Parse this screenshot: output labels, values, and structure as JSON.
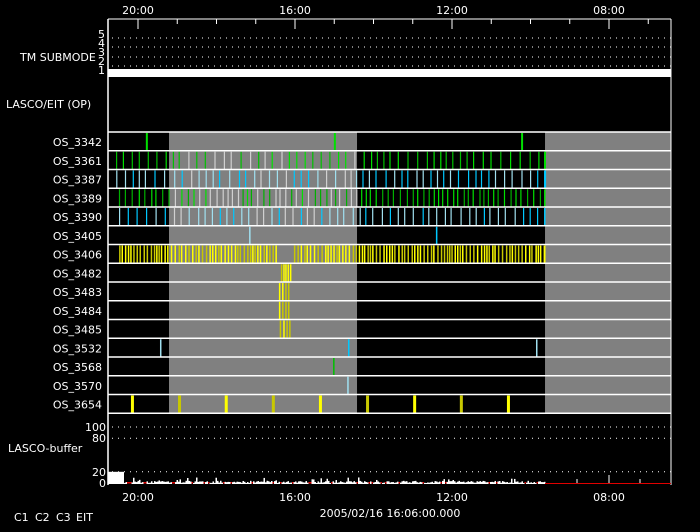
{
  "chart_data": {
    "type": "timeline",
    "x_axis": {
      "tick_labels": [
        "20:00",
        "16:00",
        "12:00",
        "08:00"
      ],
      "tick_hours": [
        20,
        16,
        12,
        8
      ],
      "range_hours": [
        20.76,
        6.42
      ]
    },
    "date_label": "2005/02/16 16:06:00.000",
    "tm_submode": {
      "label": "TM SUBMODE",
      "levels": [
        "5",
        "4",
        "3",
        "2",
        "1"
      ],
      "value": 1
    },
    "lasco_eit_label": "LASCO/EIT (OP)",
    "shaded_intervals_hours": [
      [
        19.21,
        14.42
      ],
      [
        9.63,
        6.42
      ]
    ],
    "rows": [
      {
        "name": "OS_3342",
        "events": [
          {
            "t": 19.8,
            "color": "#00e000"
          },
          {
            "t": 15.01,
            "color": "#00e000"
          },
          {
            "t": 10.24,
            "color": "#00e000"
          }
        ]
      },
      {
        "name": "OS_3361",
        "pattern": "dense",
        "colors": [
          "#00e000",
          "#00c000"
        ]
      },
      {
        "name": "OS_3387",
        "pattern": "dense",
        "colors": [
          "#00c8ff",
          "#a0e0f0"
        ]
      },
      {
        "name": "OS_3389",
        "pattern": "dense",
        "colors": [
          "#00e000",
          "#00b000"
        ]
      },
      {
        "name": "OS_3390",
        "pattern": "dense",
        "colors": [
          "#00c8ff",
          "#a0e0f0"
        ]
      },
      {
        "name": "OS_3405",
        "events": [
          {
            "t": 17.17,
            "color": "#a0e0f0"
          },
          {
            "t": 12.41,
            "color": "#00c8ff"
          }
        ]
      },
      {
        "name": "OS_3406",
        "pattern": "dense",
        "colors": [
          "#ffff00",
          "#c8c800"
        ]
      },
      {
        "name": "OS_3482",
        "events": [
          {
            "t": 16.36,
            "color": "#c8c800"
          },
          {
            "t": 16.3,
            "color": "#ffff00"
          },
          {
            "t": 16.25,
            "color": "#ffff00"
          },
          {
            "t": 16.19,
            "color": "#ffff00"
          },
          {
            "t": 16.13,
            "color": "#ffff00"
          }
        ]
      },
      {
        "name": "OS_3483",
        "events": [
          {
            "t": 16.41,
            "color": "#ffff00"
          },
          {
            "t": 16.33,
            "color": "#ffff00"
          },
          {
            "t": 16.25,
            "color": "#c8c800"
          },
          {
            "t": 16.18,
            "color": "#c8c800"
          }
        ]
      },
      {
        "name": "OS_3484",
        "events": [
          {
            "t": 16.41,
            "color": "#ffff00"
          },
          {
            "t": 16.33,
            "color": "#c8c800"
          },
          {
            "t": 16.25,
            "color": "#c8c800"
          },
          {
            "t": 16.18,
            "color": "#c8c800"
          }
        ]
      },
      {
        "name": "OS_3485",
        "events": [
          {
            "t": 16.39,
            "color": "#c8c800"
          },
          {
            "t": 16.3,
            "color": "#ffff00"
          },
          {
            "t": 16.22,
            "color": "#c8c800"
          },
          {
            "t": 16.15,
            "color": "#c8c800"
          }
        ]
      },
      {
        "name": "OS_3532",
        "events": [
          {
            "t": 19.44,
            "color": "#a0e0f0"
          },
          {
            "t": 14.65,
            "color": "#00c8ff"
          },
          {
            "t": 9.86,
            "color": "#a0e0f0"
          }
        ]
      },
      {
        "name": "OS_3568",
        "events": [
          {
            "t": 15.03,
            "color": "#00c000"
          }
        ]
      },
      {
        "name": "OS_3570",
        "events": [
          {
            "t": 14.67,
            "color": "#a0e0f0"
          }
        ]
      },
      {
        "name": "OS_3654",
        "events": [
          {
            "t": 20.18,
            "color": "#ffff00"
          },
          {
            "t": 18.98,
            "color": "#c8c800"
          },
          {
            "t": 17.79,
            "color": "#ffff00"
          },
          {
            "t": 16.59,
            "color": "#c8c800"
          },
          {
            "t": 15.39,
            "color": "#ffff00"
          },
          {
            "t": 14.19,
            "color": "#c8c800"
          },
          {
            "t": 12.99,
            "color": "#ffff00"
          },
          {
            "t": 11.8,
            "color": "#c8c800"
          },
          {
            "t": 10.6,
            "color": "#ffff00"
          }
        ]
      }
    ],
    "buffer": {
      "label": "LASCO-buffer",
      "y_tick_labels": [
        "100",
        "80",
        "20",
        "0"
      ],
      "y_ticks": [
        100,
        80,
        20,
        0
      ],
      "ylim": [
        0,
        100
      ]
    },
    "legend": [
      {
        "label": "C1",
        "color": "#ff2020"
      },
      {
        "label": "C2",
        "color": "#20ff20"
      },
      {
        "label": "C3",
        "color": "#a0e0f0"
      },
      {
        "label": "EIT",
        "color": "#ffff00"
      }
    ],
    "colors": {
      "background": "#000000",
      "shade": "#808080",
      "grid": "#ffffff"
    }
  }
}
